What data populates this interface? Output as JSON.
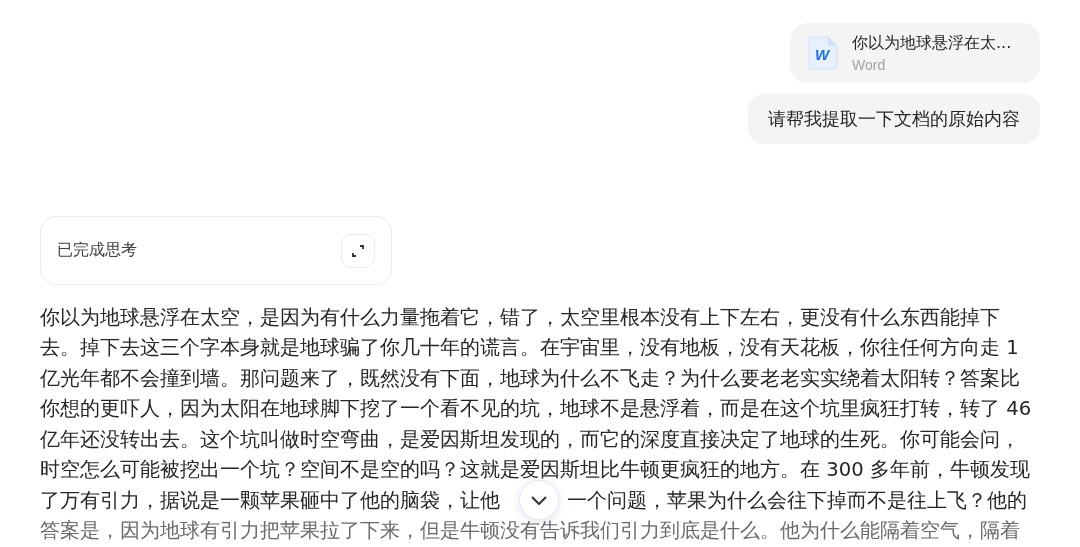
{
  "user_messages": [
    {
      "kind": "file",
      "file_name": "你以为地球悬浮在太...",
      "file_type": "Word",
      "icon_letter": "W"
    },
    {
      "kind": "text",
      "text": "请帮我提取一下文档的原始内容"
    }
  ],
  "thinking": {
    "label": "已完成思考"
  },
  "answer": {
    "lines": [
      [
        "你以为地球悬浮在太空，是因为有什么力量拖着它，错了，太空里根本没有上下左右，更没有什么东西能掉下"
      ],
      [
        "去。掉下去这三个字本身就是地球骗了你几十年的谎言。在宇宙里，没有地板，没有天花板，你往任何方向走 1"
      ],
      [
        "亿光年都不会撞到墙。那问题来了，既然没有下面，地球为什么不飞走？为什么要老老实实绕着太阳转？答案比"
      ],
      [
        "你想的更吓人，因为太阳在地球脚下挖了一个看不见的坑，地球不是悬浮着，而是在这个坑里疯狂打转，转了 46"
      ],
      [
        "亿年还没转出去。这个坑叫做时空弯曲，是爱因斯坦发现的，而它的深度直接决定了地球的生死。你可能会问，"
      ],
      [
        "时空怎么可能被挖出一个坑？空间不是空的吗？这就是爱因斯坦比牛顿更疯狂的地方。在 300 多年前，牛顿发现"
      ],
      [
        "了万有引力，据说是一颗苹果砸中了他的脑袋，让他",
        "一个问题，苹果为什么会往下掉而不是往上飞？他的"
      ],
      [
        "答案是，因为地球有引力把苹果拉了下来，但是牛顿没有告诉我们引力到底是什么。他为什么能隔着空气，隔着"
      ]
    ]
  }
}
